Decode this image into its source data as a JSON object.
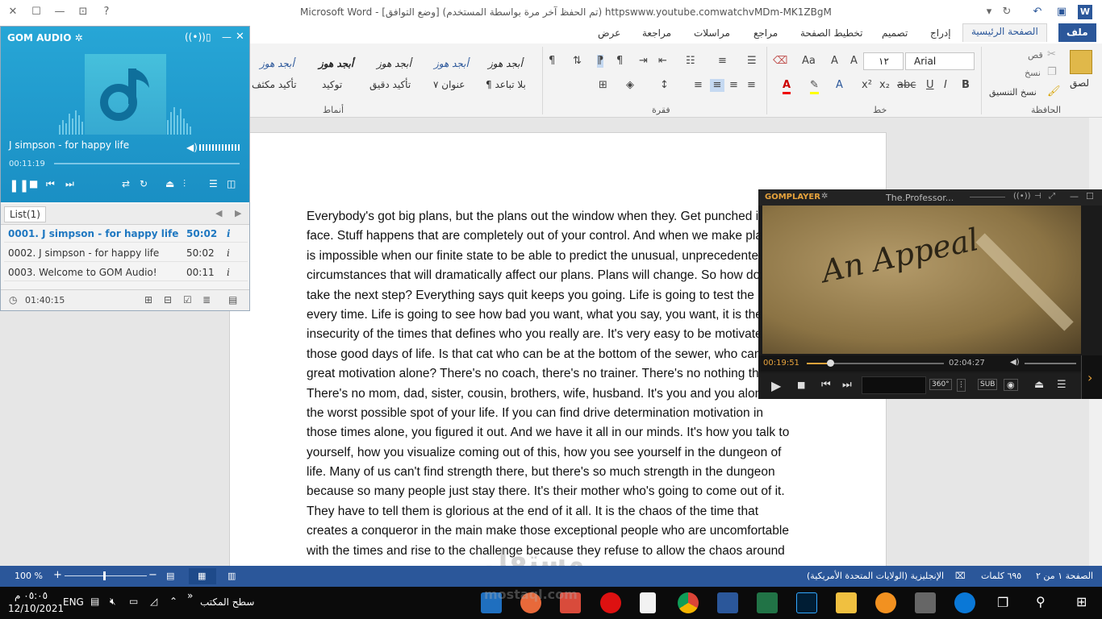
{
  "word": {
    "title": "Microsoft Word - [وضع التوافق] (تم الحفظ آخر مرة بواسطة المستخدم) httpswww.youtube.comwatchvMDm-MK1ZBgM",
    "tabs": [
      "ملف",
      "الصفحة الرئيسية",
      "إدراج",
      "تصميم",
      "تخطيط الصفحة",
      "مراجع",
      "مراسلات",
      "مراجعة",
      "عرض"
    ],
    "ribbon": {
      "clipboard": {
        "paste": "لصق",
        "cut": "قص",
        "copy": "نسخ",
        "format_painter": "نسخ التنسيق",
        "label": "الحافظة"
      },
      "font": {
        "name": "Arial",
        "size": "١٢",
        "label": "خط"
      },
      "paragraph": {
        "label": "فقرة"
      },
      "styles": {
        "label": "أنماط",
        "items": [
          {
            "preview": "أبجد هوز",
            "name": "¶ بلا تباعد"
          },
          {
            "preview": "أبجد هوز",
            "name": "عنوان ٧"
          },
          {
            "preview": "أبجد هوز",
            "name": "تأكيد دقيق"
          },
          {
            "preview": "أبجد هوز",
            "name": "توكيد"
          },
          {
            "preview": "أبجد هوز",
            "name": "تأكيد مكثف"
          }
        ]
      }
    },
    "document_lines": [
      "Everybody's got big plans, but the plans out the window when they. Get punched in the",
      "face. Stuff happens that are completely out of your control. And when we make plans, it",
      "is impossible when our finite state to be able to predict the unusual, unprecedented",
      "circumstances that will dramatically affect our plans. Plans will change. So how do you",
      "take the next step? Everything says quit keeps you going. Life is going to test the plan",
      "every time. Life is going to see how bad you want, what you say, you want, it is the",
      "insecurity of the times that defines who you really are. It's very easy to be motivated",
      "those good days of life. Is that cat who can be at the bottom of the sewer, who can find",
      "great motivation alone? There's no coach, there's no trainer. There's no nothing there.",
      "There's no mom, dad, sister, cousin, brothers, wife, husband. It's you and you alone in",
      "the worst possible spot of your life. If you can find drive determination motivation in",
      "those times alone, you figured it out. And we have it all in our minds. It's how you talk to",
      "yourself, how you visualize coming out of this, how you see yourself in the dungeon of",
      "life. Many of us can't find strength there, but there's so much strength in the dungeon",
      "because so many people just stay there. It's their mother who's going to come out of it.",
      "They have to tell them is glorious at the end of it all. It is the chaos of the time that",
      "creates a conqueror in the main make those exceptional people who are uncomfortable",
      "with the times and rise to the challenge because they refuse to allow the chaos around"
    ],
    "status": {
      "page": "الصفحة ١ من ٢",
      "words": "٦٩٥ كلمات",
      "language": "الإنجليزية (الولايات المتحدة الأمريكية)",
      "zoom": "100 %"
    }
  },
  "gom_audio": {
    "logo": "GOM AUDIO",
    "now_playing": "J simpson - for happy life",
    "elapsed": "00:11:19",
    "list_tab": "List(1)",
    "playlist": [
      {
        "title": "0001. J simpson - for happy life",
        "duration": "50:02",
        "info": "i"
      },
      {
        "title": "0002. J simpson - for happy life",
        "duration": "50:02",
        "info": "i"
      },
      {
        "title": "0003. Welcome to GOM Audio!",
        "duration": "00:11",
        "info": "i"
      }
    ],
    "total_time": "01:40:15"
  },
  "gom_player": {
    "logo": "GOMPLAYER",
    "title": "The.Professor...",
    "current": "00:19:51",
    "total": "02:04:27",
    "video_caption": "An Appeal",
    "btn_360": "360°",
    "btn_sub": "SUB"
  },
  "taskbar": {
    "time": "٠٥:٠٥ م",
    "date": "12/10/2021",
    "lang": "ENG",
    "desktop": "سطح المكتب"
  },
  "watermark": {
    "ar": "مستقل",
    "en": "mostaql.com"
  }
}
